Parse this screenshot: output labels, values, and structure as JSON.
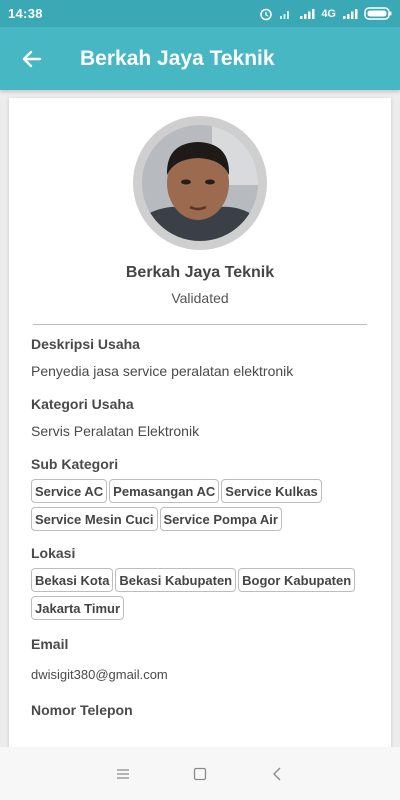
{
  "status_bar": {
    "time": "14:38",
    "network": "4G"
  },
  "app_bar": {
    "title": "Berkah Jaya Teknik"
  },
  "profile": {
    "name": "Berkah Jaya Teknik",
    "status": "Validated"
  },
  "description": {
    "label": "Deskripsi Usaha",
    "value": "Penyedia jasa service peralatan elektronik"
  },
  "category": {
    "label": "Kategori Usaha",
    "value": "Servis Peralatan Elektronik"
  },
  "sub_category": {
    "label": "Sub Kategori",
    "items": [
      "Service AC",
      "Pemasangan AC",
      "Service Kulkas",
      "Service Mesin Cuci",
      "Service Pompa Air"
    ]
  },
  "location": {
    "label": "Lokasi",
    "items": [
      "Bekasi Kota",
      "Bekasi Kabupaten",
      "Bogor Kabupaten",
      "Jakarta Timur"
    ]
  },
  "email": {
    "label": "Email",
    "value": "dwisigit380@gmail.com"
  },
  "phone": {
    "label": "Nomor Telepon"
  },
  "colors": {
    "status_bar": "#3aa8b5",
    "app_bar": "#47b7c3",
    "background": "#ececec"
  }
}
